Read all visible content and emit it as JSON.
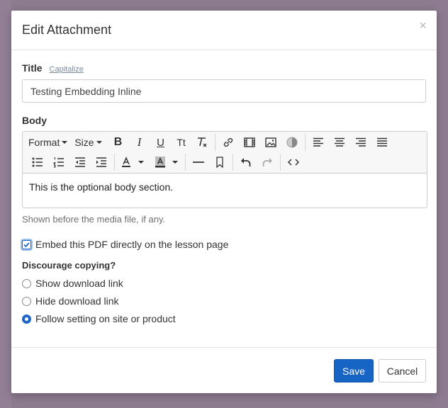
{
  "modal": {
    "title": "Edit Attachment",
    "close_glyph": "×"
  },
  "title_field": {
    "label": "Title",
    "capitalize_link": "Capitalize",
    "value": "Testing Embedding Inline"
  },
  "body_field": {
    "label": "Body",
    "toolbar": {
      "format_label": "Format",
      "size_label": "Size",
      "bold": "B",
      "italic": "I",
      "underline": "U",
      "text_transform": "Tt"
    },
    "content": "This is the optional body section.",
    "hint": "Shown before the media file, if any."
  },
  "embed_option": {
    "label": "Embed this PDF directly on the lesson page",
    "checked": true
  },
  "discourage_copying": {
    "label": "Discourage copying?",
    "options": [
      {
        "label": "Show download link",
        "checked": false
      },
      {
        "label": "Hide download link",
        "checked": false
      },
      {
        "label": "Follow setting on site or product",
        "checked": true
      }
    ]
  },
  "footer": {
    "save_label": "Save",
    "cancel_label": "Cancel"
  },
  "colors": {
    "primary": "#1664c4",
    "backdrop": "#8c7a8f"
  }
}
